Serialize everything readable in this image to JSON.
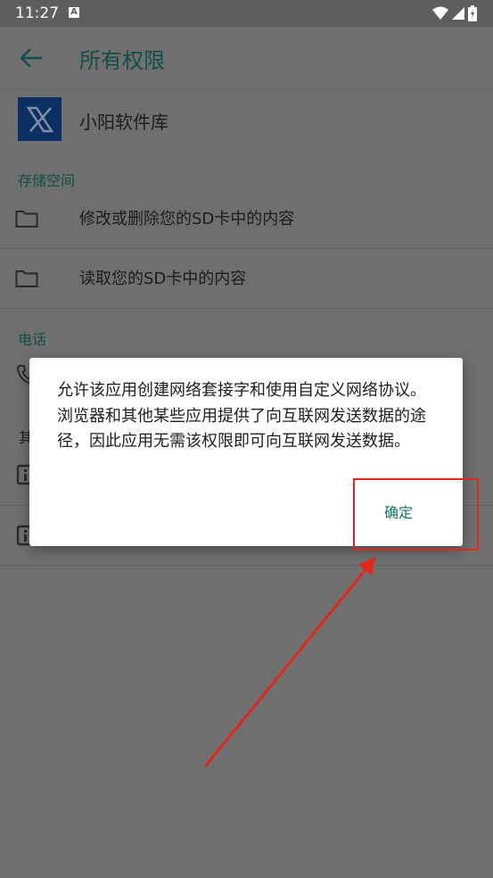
{
  "status_bar": {
    "time": "11:27",
    "notification_icon": "A"
  },
  "app_bar": {
    "title": "所有权限",
    "back_icon": "arrow-left"
  },
  "app": {
    "name": "小阳软件库",
    "logo_glyph": "X"
  },
  "sections": {
    "storage_label": "存储空间",
    "storage_items": [
      "修改或删除您的SD卡中的内容",
      "读取您的SD卡中的内容"
    ],
    "phone_label": "电话",
    "other_label_partial": "其"
  },
  "dialog": {
    "message": "允许该应用创建网络套接字和使用自定义网络协议。浏览器和其他某些应用提供了向互联网发送数据的途径，因此应用无需该权限即可向互联网发送数据。",
    "ok_label": "确定"
  },
  "colors": {
    "accent": "#0d7568",
    "annotation": "#e2271c"
  }
}
